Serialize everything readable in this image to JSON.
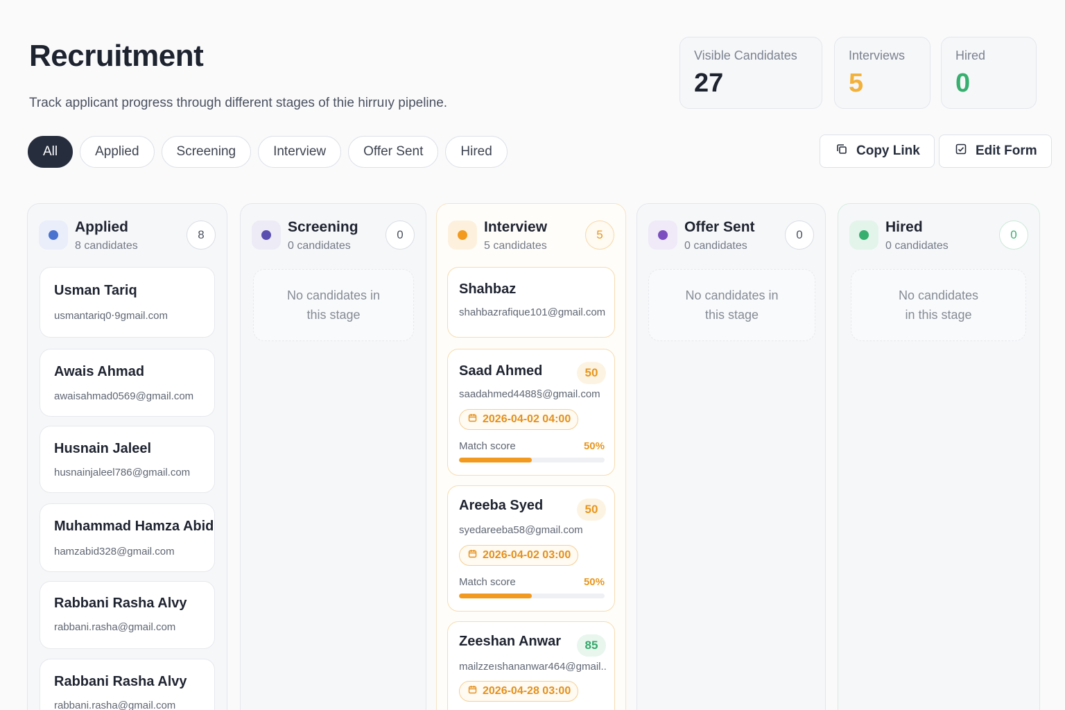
{
  "header": {
    "title": "Recruitment",
    "subtitle": "Track applicant progress through different stages of thie hirruıy pipeline."
  },
  "stats": [
    {
      "label": "Visible Candidates",
      "value": "27",
      "color": "#1e2330"
    },
    {
      "label": "Interviews",
      "value": "5",
      "color": "#f2b13a"
    },
    {
      "label": "Hired",
      "value": "0",
      "color": "#37b06f"
    }
  ],
  "filters": [
    "All",
    "Applied",
    "Screening",
    "Interview",
    "Offer Sent",
    "Hired"
  ],
  "active_filter": "All",
  "actions": {
    "copy_link": "Copy Link",
    "edit_form": "Edit Form"
  },
  "colors": {
    "applied": "#4a73d0",
    "screening": "#5b4fb0",
    "interview": "#f29a1f",
    "offer_sent": "#7b4fc0",
    "hired": "#37b06f"
  },
  "columns": {
    "applied": {
      "title": "Applied",
      "count_text": "8 candidates",
      "badge": "8",
      "cards": [
        {
          "name": "Usman Tariq",
          "email": "usmantariq0⋅9gmail.com"
        },
        {
          "name": "Awais Ahmad",
          "email": "awaisahmad0569@gmail.com"
        },
        {
          "name": "Husnain Jaleel",
          "email": "husnainjaleel786@gmail.com"
        },
        {
          "name": "Muhammad Hamza Abid",
          "email": "hamzabid328@gmail.com"
        },
        {
          "name": "Rabbani Rasha Alvy",
          "email": "rabbani.rasha@gmail.com"
        },
        {
          "name": "Rabbani Rasha Alvy",
          "email": "rabbani.rasha@gmail.com"
        }
      ]
    },
    "screening": {
      "title": "Screening",
      "count_text": "0 candidates",
      "badge": "0",
      "empty_line1": "No candidates in",
      "empty_line2": "this stage"
    },
    "interview": {
      "title": "Interview",
      "count_text": "5 candidates",
      "badge": "5",
      "cards": [
        {
          "name": "Shahbaz",
          "email": "shahbazrafique101@gmail.com"
        },
        {
          "name": "Saad Ahmed",
          "email": "saadahmed4488§@gmail.com",
          "score": "50",
          "date": "2026-04-02 04:00",
          "match_label": "Match score",
          "match_pct": "50%",
          "match_value": 0.5
        },
        {
          "name": "Areeba Syed",
          "email": "syedareeba58@gmail.com",
          "score": "50",
          "date": "2026-04-02 03:00",
          "match_label": "Match score",
          "match_pct": "50%",
          "match_value": 0.5
        },
        {
          "name": "Zeeshan Anwar",
          "email": "mailzzeıshananwar464@gmail..",
          "score": "85",
          "date": "2026-04-28 03:00"
        }
      ]
    },
    "offer_sent": {
      "title": "Offer Sent",
      "count_text": "0 candidates",
      "badge": "0",
      "empty_line1": "No candidates in",
      "empty_line2": "this stage"
    },
    "hired": {
      "title": "Hired",
      "count_text": "0 candidates",
      "badge": "0",
      "empty_line1": "No candidates",
      "empty_line2": "in this stage"
    }
  }
}
